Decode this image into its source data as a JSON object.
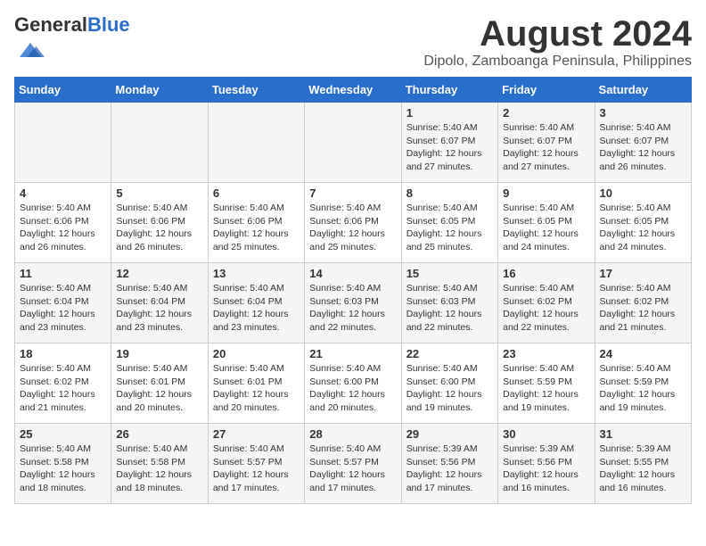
{
  "header": {
    "logo_general": "General",
    "logo_blue": "Blue",
    "month": "August 2024",
    "location": "Dipolo, Zamboanga Peninsula, Philippines"
  },
  "days_of_week": [
    "Sunday",
    "Monday",
    "Tuesday",
    "Wednesday",
    "Thursday",
    "Friday",
    "Saturday"
  ],
  "weeks": [
    [
      {
        "day": "",
        "detail": ""
      },
      {
        "day": "",
        "detail": ""
      },
      {
        "day": "",
        "detail": ""
      },
      {
        "day": "",
        "detail": ""
      },
      {
        "day": "1",
        "detail": "Sunrise: 5:40 AM\nSunset: 6:07 PM\nDaylight: 12 hours\nand 27 minutes."
      },
      {
        "day": "2",
        "detail": "Sunrise: 5:40 AM\nSunset: 6:07 PM\nDaylight: 12 hours\nand 27 minutes."
      },
      {
        "day": "3",
        "detail": "Sunrise: 5:40 AM\nSunset: 6:07 PM\nDaylight: 12 hours\nand 26 minutes."
      }
    ],
    [
      {
        "day": "4",
        "detail": "Sunrise: 5:40 AM\nSunset: 6:06 PM\nDaylight: 12 hours\nand 26 minutes."
      },
      {
        "day": "5",
        "detail": "Sunrise: 5:40 AM\nSunset: 6:06 PM\nDaylight: 12 hours\nand 26 minutes."
      },
      {
        "day": "6",
        "detail": "Sunrise: 5:40 AM\nSunset: 6:06 PM\nDaylight: 12 hours\nand 25 minutes."
      },
      {
        "day": "7",
        "detail": "Sunrise: 5:40 AM\nSunset: 6:06 PM\nDaylight: 12 hours\nand 25 minutes."
      },
      {
        "day": "8",
        "detail": "Sunrise: 5:40 AM\nSunset: 6:05 PM\nDaylight: 12 hours\nand 25 minutes."
      },
      {
        "day": "9",
        "detail": "Sunrise: 5:40 AM\nSunset: 6:05 PM\nDaylight: 12 hours\nand 24 minutes."
      },
      {
        "day": "10",
        "detail": "Sunrise: 5:40 AM\nSunset: 6:05 PM\nDaylight: 12 hours\nand 24 minutes."
      }
    ],
    [
      {
        "day": "11",
        "detail": "Sunrise: 5:40 AM\nSunset: 6:04 PM\nDaylight: 12 hours\nand 23 minutes."
      },
      {
        "day": "12",
        "detail": "Sunrise: 5:40 AM\nSunset: 6:04 PM\nDaylight: 12 hours\nand 23 minutes."
      },
      {
        "day": "13",
        "detail": "Sunrise: 5:40 AM\nSunset: 6:04 PM\nDaylight: 12 hours\nand 23 minutes."
      },
      {
        "day": "14",
        "detail": "Sunrise: 5:40 AM\nSunset: 6:03 PM\nDaylight: 12 hours\nand 22 minutes."
      },
      {
        "day": "15",
        "detail": "Sunrise: 5:40 AM\nSunset: 6:03 PM\nDaylight: 12 hours\nand 22 minutes."
      },
      {
        "day": "16",
        "detail": "Sunrise: 5:40 AM\nSunset: 6:02 PM\nDaylight: 12 hours\nand 22 minutes."
      },
      {
        "day": "17",
        "detail": "Sunrise: 5:40 AM\nSunset: 6:02 PM\nDaylight: 12 hours\nand 21 minutes."
      }
    ],
    [
      {
        "day": "18",
        "detail": "Sunrise: 5:40 AM\nSunset: 6:02 PM\nDaylight: 12 hours\nand 21 minutes."
      },
      {
        "day": "19",
        "detail": "Sunrise: 5:40 AM\nSunset: 6:01 PM\nDaylight: 12 hours\nand 20 minutes."
      },
      {
        "day": "20",
        "detail": "Sunrise: 5:40 AM\nSunset: 6:01 PM\nDaylight: 12 hours\nand 20 minutes."
      },
      {
        "day": "21",
        "detail": "Sunrise: 5:40 AM\nSunset: 6:00 PM\nDaylight: 12 hours\nand 20 minutes."
      },
      {
        "day": "22",
        "detail": "Sunrise: 5:40 AM\nSunset: 6:00 PM\nDaylight: 12 hours\nand 19 minutes."
      },
      {
        "day": "23",
        "detail": "Sunrise: 5:40 AM\nSunset: 5:59 PM\nDaylight: 12 hours\nand 19 minutes."
      },
      {
        "day": "24",
        "detail": "Sunrise: 5:40 AM\nSunset: 5:59 PM\nDaylight: 12 hours\nand 19 minutes."
      }
    ],
    [
      {
        "day": "25",
        "detail": "Sunrise: 5:40 AM\nSunset: 5:58 PM\nDaylight: 12 hours\nand 18 minutes."
      },
      {
        "day": "26",
        "detail": "Sunrise: 5:40 AM\nSunset: 5:58 PM\nDaylight: 12 hours\nand 18 minutes."
      },
      {
        "day": "27",
        "detail": "Sunrise: 5:40 AM\nSunset: 5:57 PM\nDaylight: 12 hours\nand 17 minutes."
      },
      {
        "day": "28",
        "detail": "Sunrise: 5:40 AM\nSunset: 5:57 PM\nDaylight: 12 hours\nand 17 minutes."
      },
      {
        "day": "29",
        "detail": "Sunrise: 5:39 AM\nSunset: 5:56 PM\nDaylight: 12 hours\nand 17 minutes."
      },
      {
        "day": "30",
        "detail": "Sunrise: 5:39 AM\nSunset: 5:56 PM\nDaylight: 12 hours\nand 16 minutes."
      },
      {
        "day": "31",
        "detail": "Sunrise: 5:39 AM\nSunset: 5:55 PM\nDaylight: 12 hours\nand 16 minutes."
      }
    ]
  ]
}
